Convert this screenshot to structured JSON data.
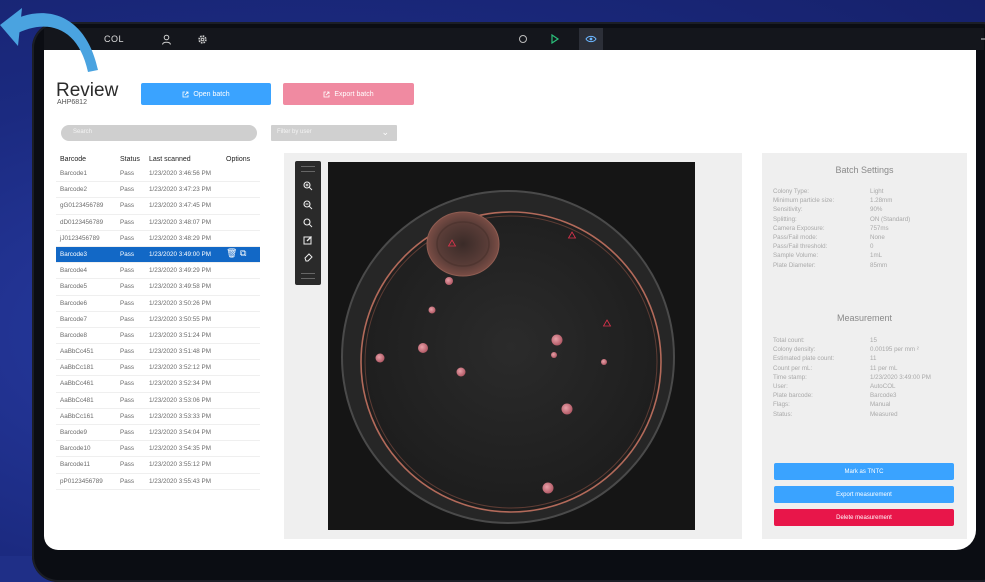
{
  "titlebar": {
    "logo": "COL",
    "icons": [
      "user-icon",
      "gear-icon",
      "circle-icon",
      "play-icon",
      "eye-icon",
      "minimize-icon",
      "maximize-icon"
    ]
  },
  "header": {
    "title": "Review",
    "batch_id": "AHP6812",
    "open_batch": "Open batch",
    "export_batch": "Export batch"
  },
  "search": {
    "placeholder": "Search"
  },
  "filter": {
    "label": "Filter by user"
  },
  "table": {
    "headers": [
      "Barcode",
      "Status",
      "Last scanned",
      "Options"
    ],
    "rows": [
      {
        "barcode": "Barcode1",
        "status": "Pass",
        "scanned": "1/23/2020 3:46:56 PM"
      },
      {
        "barcode": "Barcode2",
        "status": "Pass",
        "scanned": "1/23/2020 3:47:23 PM"
      },
      {
        "barcode": "gG0123456789",
        "status": "Pass",
        "scanned": "1/23/2020 3:47:45 PM"
      },
      {
        "barcode": "dD0123456789",
        "status": "Pass",
        "scanned": "1/23/2020 3:48:07 PM"
      },
      {
        "barcode": "jJ0123456789",
        "status": "Pass",
        "scanned": "1/23/2020 3:48:29 PM"
      },
      {
        "barcode": "Barcode3",
        "status": "Pass",
        "scanned": "1/23/2020 3:49:00 PM",
        "selected": true
      },
      {
        "barcode": "Barcode4",
        "status": "Pass",
        "scanned": "1/23/2020 3:49:29 PM"
      },
      {
        "barcode": "Barcode5",
        "status": "Pass",
        "scanned": "1/23/2020 3:49:58 PM"
      },
      {
        "barcode": "Barcode6",
        "status": "Pass",
        "scanned": "1/23/2020 3:50:26 PM"
      },
      {
        "barcode": "Barcode7",
        "status": "Pass",
        "scanned": "1/23/2020 3:50:55 PM"
      },
      {
        "barcode": "Barcode8",
        "status": "Pass",
        "scanned": "1/23/2020 3:51:24 PM"
      },
      {
        "barcode": "AaBbCc451",
        "status": "Pass",
        "scanned": "1/23/2020 3:51:48 PM"
      },
      {
        "barcode": "AaBbCc181",
        "status": "Pass",
        "scanned": "1/23/2020 3:52:12 PM"
      },
      {
        "barcode": "AaBbCc461",
        "status": "Pass",
        "scanned": "1/23/2020 3:52:34 PM"
      },
      {
        "barcode": "AaBbCc481",
        "status": "Pass",
        "scanned": "1/23/2020 3:53:06 PM"
      },
      {
        "barcode": "AaBbCc161",
        "status": "Pass",
        "scanned": "1/23/2020 3:53:33 PM"
      },
      {
        "barcode": "Barcode9",
        "status": "Pass",
        "scanned": "1/23/2020 3:54:04 PM"
      },
      {
        "barcode": "Barcode10",
        "status": "Pass",
        "scanned": "1/23/2020 3:54:35 PM"
      },
      {
        "barcode": "Barcode11",
        "status": "Pass",
        "scanned": "1/23/2020 3:55:12 PM"
      },
      {
        "barcode": "pP0123456789",
        "status": "Pass",
        "scanned": "1/23/2020 3:55:43 PM"
      }
    ]
  },
  "viewer": {
    "tools": [
      "zoom-in-icon",
      "zoom-out-icon",
      "zoom-reset-icon",
      "edit-icon",
      "eraser-icon"
    ]
  },
  "batch_settings": {
    "title": "Batch Settings",
    "items": [
      {
        "k": "Colony Type:",
        "v": "Light"
      },
      {
        "k": "Minimum particle size:",
        "v": "1.28mm"
      },
      {
        "k": "Sensitivity:",
        "v": "90%"
      },
      {
        "k": "Splitting:",
        "v": "ON (Standard)"
      },
      {
        "k": "Camera Exposure:",
        "v": "757ms"
      },
      {
        "k": "Pass/Fail mode:",
        "v": "None"
      },
      {
        "k": "Pass/Fail threshold:",
        "v": "0"
      },
      {
        "k": "Sample Volume:",
        "v": "1mL"
      },
      {
        "k": "Plate Diameter:",
        "v": "85mm"
      }
    ]
  },
  "measurement": {
    "title": "Measurement",
    "items": [
      {
        "k": "Total count:",
        "v": "15"
      },
      {
        "k": "Colony density:",
        "v": "0.00195 per mm ²"
      },
      {
        "k": "Estimated plate count:",
        "v": "11"
      },
      {
        "k": "Count per mL:",
        "v": "11 per mL"
      },
      {
        "k": "Time stamp:",
        "v": "1/23/2020 3:49:00 PM"
      },
      {
        "k": "User:",
        "v": "AutoCOL"
      },
      {
        "k": "Plate barcode:",
        "v": "Barcode3"
      },
      {
        "k": "Flags:",
        "v": "Manual"
      },
      {
        "k": "Status:",
        "v": "Measured"
      }
    ],
    "mark_tntc": "Mark as TNTC",
    "export": "Export measurement",
    "delete": "Delete measurement"
  },
  "colors": {
    "primary": "#3aa3ff",
    "selected": "#1268c6",
    "export_pink": "#f08aa1",
    "danger": "#e8164a",
    "back_arrow": "#4aa3e0"
  }
}
